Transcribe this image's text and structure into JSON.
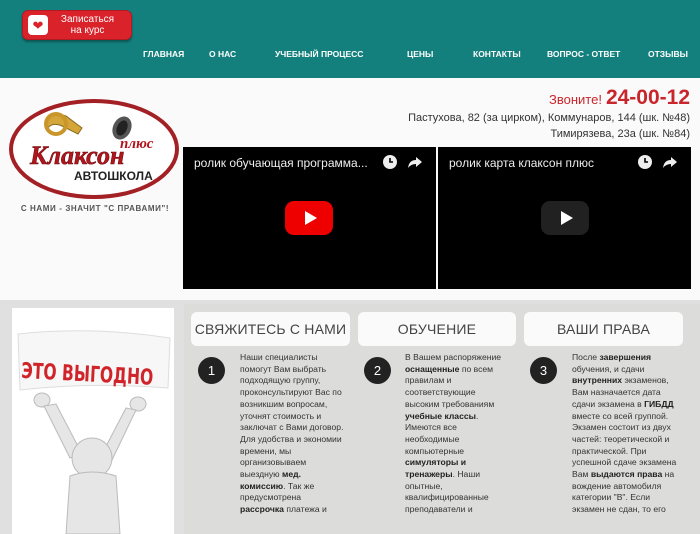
{
  "signup": {
    "label_line1": "Записаться",
    "label_line2": "на курс"
  },
  "nav": [
    "ГЛАВНАЯ",
    "О НАС",
    "УЧЕБНЫЙ ПРОЦЕСС",
    "ЦЕНЫ",
    "КОНТАКТЫ",
    "ВОПРОС - ОТВЕТ",
    "ОТЗЫВЫ"
  ],
  "logo": {
    "brand": "Клаксон",
    "suffix": "плюс",
    "school": "АВТОШКОЛА"
  },
  "slogan": "С НАМИ - ЗНАЧИТ \"С ПРАВАМИ\"!",
  "contact": {
    "call_label": "Звоните!",
    "phone": "24-00-12",
    "address1": "Пастухова, 82 (за цирком), Коммунаров, 144 (шк. №48)",
    "address2": "Тимирязева, 23а (шк. №84)"
  },
  "videos": [
    {
      "title": "ролик обучающая программа..."
    },
    {
      "title": "ролик карта клаксон плюс"
    }
  ],
  "promo": {
    "text": "ЭТО ВЫГОДНО"
  },
  "tabs": [
    "СВЯЖИТЕСЬ С НАМИ",
    "ОБУЧЕНИЕ",
    "ВАШИ ПРАВА"
  ],
  "steps": {
    "s1": {
      "num": "1",
      "p1": "Наши специалисты помогут Вам выбрать подходящую группу, проконсультируют Вас по возникшим вопросам, уточнят стоимость и заключат с Вами договор. Для удобства и экономии времени, мы организовываем выездную",
      "b1": "мед. комиссию",
      "p2": ". Так же предусмотрена",
      "b2": "рассрочка",
      "p3": "платежа и"
    },
    "s2": {
      "num": "2",
      "p1": "В Вашем распоряжение",
      "b1": "оснащенные",
      "p2": "по всем правилам и соответствующие высоким требованиям",
      "b2": "учебные классы",
      "p3": ". Имеются все необходимые компьютерные",
      "b3": "симуляторы и тренажеры",
      "p4": ". Наши опытные, квалифицированные преподаватели и"
    },
    "s3": {
      "num": "3",
      "p1": "После",
      "b1": "завершения",
      "p2": "обучения, и сдачи",
      "b2": "внутренних",
      "p3": "экзаменов, Вам назначается дата сдачи экзамена в",
      "b3": "ГИБДД",
      "p4": "вместе со всей группой. Экзамен состоит из двух частей: теоретической и практической. При успешной сдаче экзамена Вам",
      "b4": "выдаются права",
      "p5": "на вождение автомобиля категории \"B\". Если экзамен не сдан, то его"
    }
  },
  "colors": {
    "teal": "#13807d",
    "red": "#d9222a",
    "phone_red": "#c8262c"
  }
}
